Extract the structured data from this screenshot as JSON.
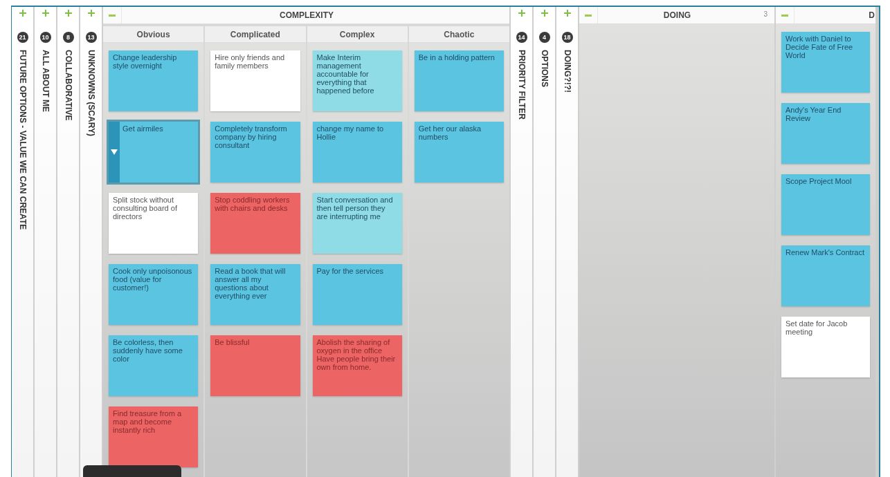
{
  "lanes": [
    {
      "kind": "collapsed",
      "title": "FUTURE OPTIONS - VALUE WE CAN CREATE",
      "count": "21"
    },
    {
      "kind": "collapsed",
      "title": "ALL ABOUT ME",
      "count": "10"
    },
    {
      "kind": "collapsed",
      "title": "COLLABORATIVE",
      "count": "8"
    },
    {
      "kind": "collapsed",
      "title": "UNKNOWNS (SCARY)",
      "count": "13"
    },
    {
      "kind": "group",
      "title": "COMPLEXITY",
      "columns": [
        {
          "title": "Obvious",
          "cards": [
            {
              "text": "Change leadership style overnight",
              "color": "#5bc4e0",
              "selected": false
            },
            {
              "text": "Get airmiles",
              "color": "#5bc4e0",
              "selected": true
            },
            {
              "text": "Split stock without consulting board of directors",
              "color": "#ffffff",
              "selected": false
            },
            {
              "text": "Cook only unpoisonous food (value for customer!)",
              "color": "#5bc4e0",
              "selected": false
            },
            {
              "text": "Be colorless, then suddenly have some color",
              "color": "#5bc4e0",
              "selected": false
            },
            {
              "text": "Find treasure from a map and become instantly rich",
              "color": "#ec6464",
              "selected": false
            }
          ]
        },
        {
          "title": "Complicated",
          "cards": [
            {
              "text": "Hire only friends and family members",
              "color": "#ffffff",
              "selected": false
            },
            {
              "text": "Completely transform company by hiring consultant",
              "color": "#5bc4e0",
              "selected": false
            },
            {
              "text": "Stop coddling workers with chairs and desks",
              "color": "#ec6464",
              "selected": false
            },
            {
              "text": "Read a book that will answer all my questions about everything ever",
              "color": "#5bc4e0",
              "selected": false
            },
            {
              "text": "Be blissful",
              "color": "#ec6464",
              "selected": false
            }
          ]
        },
        {
          "title": "Complex",
          "cards": [
            {
              "text": "Make Interim management accountable for everything that happened before",
              "color": "#8fdbe6",
              "selected": false
            },
            {
              "text": "change my name to Hollie",
              "color": "#5bc4e0",
              "selected": false
            },
            {
              "text": "Start conversation and then tell person they are interrupting me",
              "color": "#8fdbe6",
              "selected": false
            },
            {
              "text": "Pay for the services",
              "color": "#5bc4e0",
              "selected": false
            },
            {
              "text": "Abolish the sharing of oxygen in the office  Have people bring their own from home.",
              "color": "#ec6464",
              "selected": false
            }
          ]
        },
        {
          "title": "Chaotic",
          "cards": [
            {
              "text": "Be in a holding pattern",
              "color": "#5bc4e0",
              "selected": false
            },
            {
              "text": "Get her our alaska numbers",
              "color": "#5bc4e0",
              "selected": false
            }
          ]
        }
      ]
    },
    {
      "kind": "collapsed",
      "title": "PRIORITY FILTER",
      "count": "14"
    },
    {
      "kind": "collapsed",
      "title": "OPTIONS",
      "count": "4"
    },
    {
      "kind": "collapsed",
      "title": "DOING?!?!",
      "count": "18"
    },
    {
      "kind": "column",
      "title": "DOING",
      "count": "3"
    },
    {
      "kind": "column",
      "title": "D",
      "cards": [
        {
          "text": "Work with Daniel to Decide Fate of Free World",
          "color": "#5bc4e0",
          "selected": false
        },
        {
          "text": "Andy's Year End Review",
          "color": "#5bc4e0",
          "selected": false
        },
        {
          "text": "Scope Project Mool",
          "color": "#5bc4e0",
          "selected": false
        },
        {
          "text": "Renew Mark's Contract",
          "color": "#5bc4e0",
          "selected": false
        },
        {
          "text": "Set date for Jacob meeting",
          "color": "#ffffff",
          "selected": false
        }
      ]
    }
  ]
}
